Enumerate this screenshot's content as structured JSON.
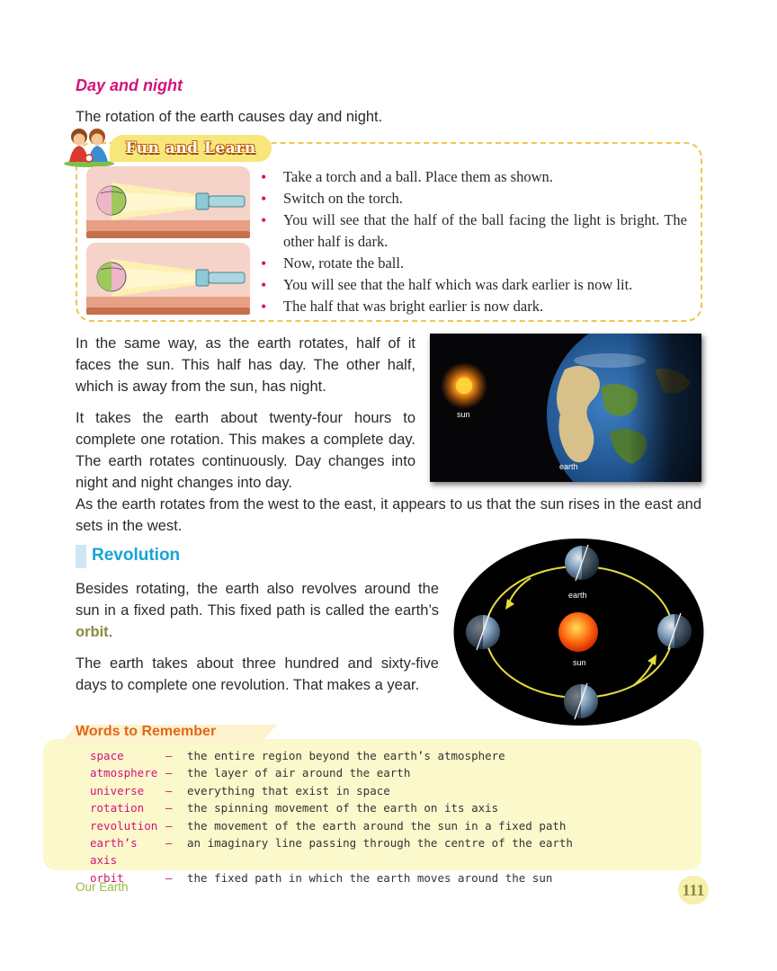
{
  "section_day": {
    "heading": "Day and night",
    "intro": "The rotation of the earth causes day and night."
  },
  "fun_and_learn": {
    "title": "Fun and Learn",
    "items": [
      "Take a torch and a ball. Place them as shown.",
      "Switch on the torch.",
      "You will see that the half of the ball facing the light is bright. The other half is dark.",
      "Now, rotate the ball.",
      "You will see that the half which was dark earlier is now lit.",
      "The half that was bright earlier is now dark."
    ]
  },
  "paragraphs": {
    "rotate": "In the same way, as the earth rotates, half of it faces the sun. This half has day. The other half, which is away from the sun, has night.",
    "hours": "It takes the earth about twenty-four hours to complete one rotation. This makes a complete day. The earth rotates continuously. Day changes into night and night changes into day.",
    "east_west": "As the earth rotates from the west to the east, it appears to us that the sun rises in the east and sets in the west."
  },
  "photo_labels": {
    "sun": "sun",
    "earth": "earth"
  },
  "section_revolution": {
    "heading": "Revolution",
    "para1_before": "Besides rotating, the earth also revolves around the sun in a fixed path. This fixed path is called the earth’s ",
    "para1_term": "orbit",
    "para1_after": ".",
    "para2": "The earth takes about three hundred and sixty-five days to complete one revolution. That makes a year."
  },
  "diagram_labels": {
    "earth": "earth",
    "sun": "sun"
  },
  "words_to_remember": {
    "heading": "Words to Remember",
    "dash": "–",
    "words": [
      {
        "term": "space",
        "definition": "the entire region beyond the earth’s atmosphere"
      },
      {
        "term": "atmosphere",
        "definition": "the layer of air around the earth"
      },
      {
        "term": "universe",
        "definition": "everything that exist in space"
      },
      {
        "term": "rotation",
        "definition": "the spinning movement of the earth on its axis"
      },
      {
        "term": "revolution",
        "definition": "the movement of the earth around the sun in a fixed path"
      },
      {
        "term": "earth’s axis",
        "definition": "an imaginary line passing through the centre of the earth"
      },
      {
        "term": "orbit",
        "definition": "the fixed path in which the earth moves around the sun"
      }
    ]
  },
  "footer": {
    "chapter": "Our Earth",
    "page": "111"
  },
  "colors": {
    "heading_magenta": "#d4127a",
    "heading_blue": "#17a3d7",
    "words_heading": "#e2661a",
    "footer_green": "#9cbc3a",
    "box_yellow": "#fbf8cc"
  }
}
